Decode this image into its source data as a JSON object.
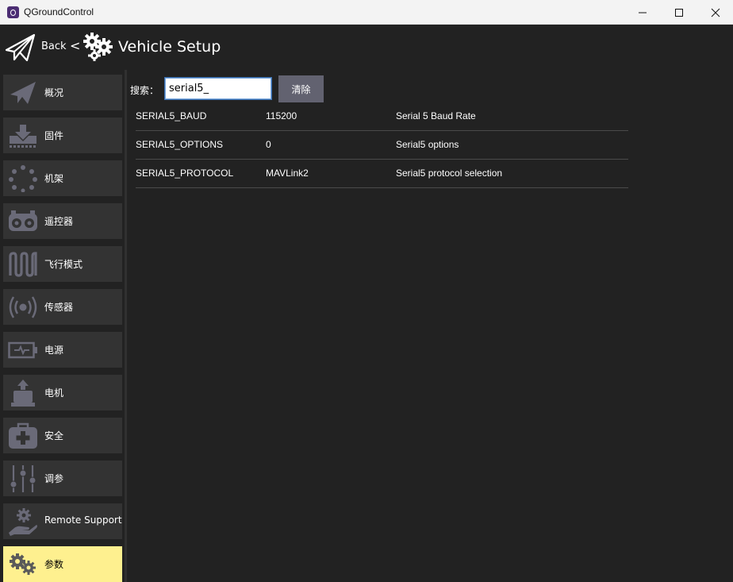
{
  "window": {
    "title": "QGroundControl",
    "icon": "qgc-app-icon"
  },
  "toolbar": {
    "back_label": "Back",
    "back_arrow": "<",
    "title": "Vehicle Setup"
  },
  "sidebar": {
    "items": [
      {
        "label": "概况",
        "icon": "paper-plane-icon",
        "active": false
      },
      {
        "label": "固件",
        "icon": "download-tray-icon",
        "active": false
      },
      {
        "label": "机架",
        "icon": "frame-dots-icon",
        "active": false
      },
      {
        "label": "遥控器",
        "icon": "radio-controller-icon",
        "active": false
      },
      {
        "label": "飞行模式",
        "icon": "waveform-icon",
        "active": false
      },
      {
        "label": "传感器",
        "icon": "sensor-signal-icon",
        "active": false
      },
      {
        "label": "电源",
        "icon": "battery-icon",
        "active": false
      },
      {
        "label": "电机",
        "icon": "motor-icon",
        "active": false
      },
      {
        "label": "安全",
        "icon": "first-aid-kit-icon",
        "active": false
      },
      {
        "label": "调参",
        "icon": "tuning-sliders-icon",
        "active": false
      },
      {
        "label": "Remote Support",
        "icon": "support-hand-gear-icon",
        "active": false
      },
      {
        "label": "参数",
        "icon": "gears-icon",
        "active": true
      }
    ]
  },
  "search": {
    "label": "搜索：",
    "value": "serial5_",
    "clear_label": "清除"
  },
  "parameters": [
    {
      "name": "SERIAL5_BAUD",
      "value": "115200",
      "description": "Serial 5 Baud Rate"
    },
    {
      "name": "SERIAL5_OPTIONS",
      "value": "0",
      "description": "Serial5 options"
    },
    {
      "name": "SERIAL5_PROTOCOL",
      "value": "MAVLink2",
      "description": "Serial5 protocol selection"
    }
  ],
  "colors": {
    "background": "#222222",
    "nav_item": "#333333",
    "nav_active": "#fef08f",
    "icon_gray": "#6a6a78",
    "button": "#626270"
  }
}
